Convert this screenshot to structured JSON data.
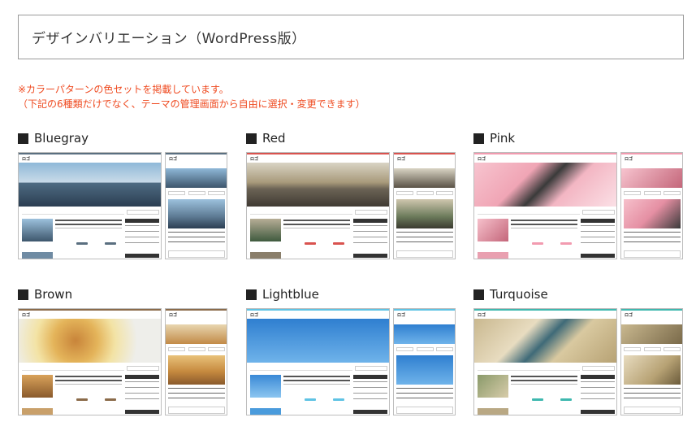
{
  "header": {
    "title": "デザインバリエーション（WordPress版）"
  },
  "notice": {
    "line1": "※カラーパターンの色セットを掲載しています。",
    "line2": "（下記の6種類だけでなく、テーマの管理画面から自由に選択・変更できます）"
  },
  "themes": [
    {
      "label": "Bluegray",
      "accent": "#5a6f80"
    },
    {
      "label": "Red",
      "accent": "#d9534f"
    },
    {
      "label": "Pink",
      "accent": "#f29bb0"
    },
    {
      "label": "Brown",
      "accent": "#8b6b4a"
    },
    {
      "label": "Lightblue",
      "accent": "#5fc3e4"
    },
    {
      "label": "Turquoise",
      "accent": "#3fb8af"
    }
  ]
}
